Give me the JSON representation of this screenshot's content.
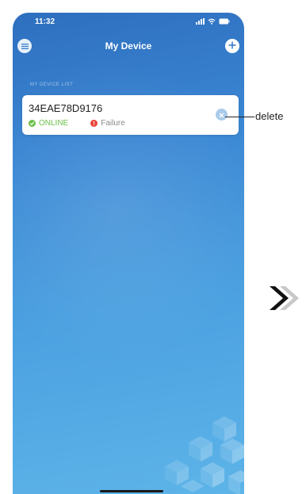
{
  "status_bar": {
    "time": "11:32",
    "icons": [
      "signal-icon",
      "wifi-icon",
      "battery-icon"
    ]
  },
  "nav": {
    "title": "My Device",
    "left_icon": "menu-icon",
    "right_icon": "add-icon"
  },
  "section": {
    "label": "MY DEVICE LIST"
  },
  "device": {
    "id": "34EAE78D9176",
    "status_online": "ONLINE",
    "status_failure": "Failure",
    "delete_icon": "close-icon"
  },
  "annotation": {
    "label": "delete"
  },
  "colors": {
    "background_top": "#2e6fbf",
    "background_bottom": "#5db4e8",
    "online": "#6cc04a",
    "failure": "#e8433a",
    "card": "#ffffff"
  }
}
